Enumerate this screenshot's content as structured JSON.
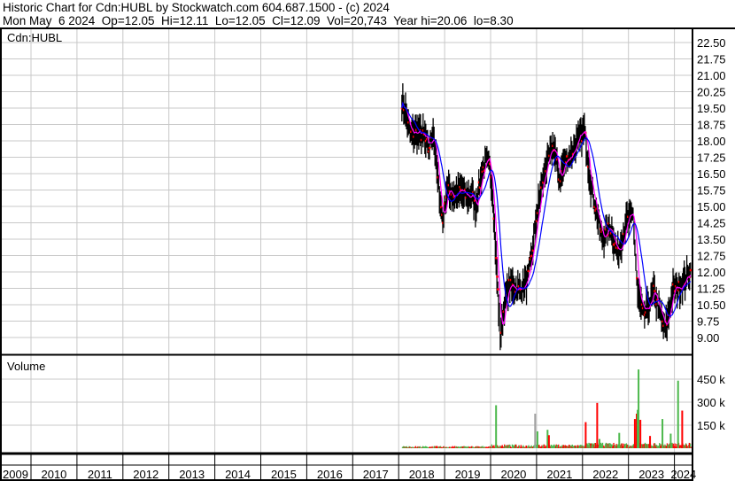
{
  "header": {
    "title": "Historic Chart for Cdn:HUBL by Stockwatch.com 604.687.1500 - (c) 2024",
    "quote": "Mon May  6 2024  Op=12.05  Hi=12.11  Lo=12.05  Cl=12.09  Vol=20,743  Year hi=20.06  lo=8.30"
  },
  "chart_data": [
    {
      "type": "line",
      "title": "Cdn:HUBL",
      "ylim": [
        8.3,
        23.0
      ],
      "yticks": [
        "22.50",
        "21.75",
        "21.00",
        "20.25",
        "19.50",
        "18.75",
        "18.00",
        "17.25",
        "16.50",
        "15.75",
        "15.00",
        "14.25",
        "13.50",
        "12.75",
        "12.00",
        "11.25",
        "10.50",
        "9.75",
        "9.00"
      ],
      "xlim": [
        2009.0,
        2024.4
      ],
      "years": [
        "2009",
        "2010",
        "2011",
        "2012",
        "2013",
        "2014",
        "2015",
        "2016",
        "2017",
        "2018",
        "2019",
        "2020",
        "2021",
        "2022",
        "2023",
        "2024"
      ],
      "grid": true,
      "series": [
        {
          "name": "price",
          "color": "#000000",
          "up_color": "#ff0000",
          "x": [
            2018.07,
            2018.15,
            2018.25,
            2018.4,
            2018.55,
            2018.65,
            2018.75,
            2018.85,
            2018.96,
            2019.05,
            2019.2,
            2019.35,
            2019.5,
            2019.6,
            2019.67,
            2019.8,
            2019.9,
            2019.98,
            2020.05,
            2020.12,
            2020.21,
            2020.3,
            2020.4,
            2020.5,
            2020.65,
            2020.8,
            2020.9,
            2021.0,
            2021.1,
            2021.2,
            2021.37,
            2021.5,
            2021.6,
            2021.75,
            2021.85,
            2022.04,
            2022.18,
            2022.3,
            2022.43,
            2022.6,
            2022.77,
            2022.95,
            2023.1,
            2023.2,
            2023.33,
            2023.45,
            2023.55,
            2023.7,
            2023.8,
            2023.97,
            2024.1,
            2024.25,
            2024.35
          ],
          "y": [
            19.8,
            19.3,
            18.3,
            18.4,
            18.2,
            17.6,
            18.5,
            16.2,
            14.3,
            15.8,
            15.5,
            15.7,
            15.4,
            15.6,
            14.9,
            16.5,
            17.1,
            16.8,
            15.5,
            12.5,
            9.0,
            10.5,
            11.4,
            11.3,
            11.2,
            11.6,
            12.8,
            14.5,
            15.8,
            16.8,
            17.8,
            16.2,
            17.0,
            17.4,
            17.8,
            18.5,
            16.0,
            14.8,
            13.5,
            14.1,
            12.8,
            14.3,
            14.6,
            11.0,
            10.0,
            10.5,
            11.1,
            10.0,
            9.3,
            11.2,
            11.3,
            11.7,
            12.09
          ]
        },
        {
          "name": "short moving average",
          "color": "#ff00ff"
        },
        {
          "name": "long moving average",
          "color": "#0000ff"
        }
      ]
    },
    {
      "type": "bar",
      "title": "Volume",
      "yticks": [
        "450 k",
        "300 k",
        "150 k"
      ],
      "ylim": [
        0,
        550000
      ],
      "spikes": [
        {
          "x": 2020.1,
          "v": 280000,
          "c": "#4cb84c"
        },
        {
          "x": 2020.95,
          "v": 225000,
          "c": "#a0a0a0"
        },
        {
          "x": 2021.0,
          "v": 110000,
          "c": "#4cb84c"
        },
        {
          "x": 2021.22,
          "v": 120000,
          "c": "#4cb84c"
        },
        {
          "x": 2021.25,
          "v": 85000,
          "c": "#ff0000"
        },
        {
          "x": 2022.05,
          "v": 170000,
          "c": "#ff0000"
        },
        {
          "x": 2022.3,
          "v": 295000,
          "c": "#ff0000"
        },
        {
          "x": 2022.35,
          "v": 60000,
          "c": "#4cb84c"
        },
        {
          "x": 2022.78,
          "v": 100000,
          "c": "#4cb84c"
        },
        {
          "x": 2023.12,
          "v": 190000,
          "c": "#ff0000"
        },
        {
          "x": 2023.16,
          "v": 225000,
          "c": "#ff0000"
        },
        {
          "x": 2023.18,
          "v": 250000,
          "c": "#4cb84c"
        },
        {
          "x": 2023.2,
          "v": 513000,
          "c": "#4cb84c"
        },
        {
          "x": 2023.24,
          "v": 185000,
          "c": "#ff0000"
        },
        {
          "x": 2023.45,
          "v": 80000,
          "c": "#ff0000"
        },
        {
          "x": 2023.72,
          "v": 190000,
          "c": "#4cb84c"
        },
        {
          "x": 2023.9,
          "v": 95000,
          "c": "#4cb84c"
        },
        {
          "x": 2024.06,
          "v": 440000,
          "c": "#4cb84c"
        },
        {
          "x": 2024.15,
          "v": 245000,
          "c": "#ff0000"
        }
      ]
    }
  ]
}
